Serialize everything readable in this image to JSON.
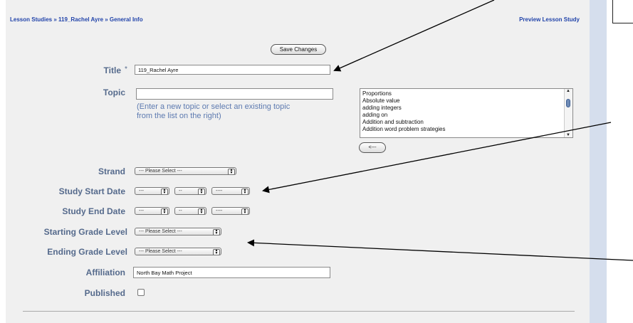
{
  "breadcrumb": {
    "text": "Lesson Studies » 119_Rachel Ayre » General Info",
    "preview_link": "Preview Lesson Study"
  },
  "save_button": "Save Changes",
  "form": {
    "title": {
      "label": "Title",
      "required_mark": "*",
      "value": "119_Rachel Ayre"
    },
    "topic": {
      "label": "Topic",
      "value": "",
      "hint": "(Enter a new topic or select an existing topic from the list on the right)",
      "options": [
        "Proportions",
        "Absolute value",
        "adding integers",
        "adding on",
        "Addition and subtraction",
        "Addition word problem strategies"
      ],
      "add_button": "<---"
    },
    "strand": {
      "label": "Strand",
      "selected": "--- Please Select ---"
    },
    "study_start_date": {
      "label": "Study Start Date",
      "month": "---",
      "day": "--",
      "year": "----"
    },
    "study_end_date": {
      "label": "Study End Date",
      "month": "---",
      "day": "--",
      "year": "----"
    },
    "starting_grade_level": {
      "label": "Starting Grade Level",
      "selected": "--- Please Select ---"
    },
    "ending_grade_level": {
      "label": "Ending Grade Level",
      "selected": "--- Please Select ---"
    },
    "affiliation": {
      "label": "Affiliation",
      "value": "North Bay Math Project"
    },
    "published": {
      "label": "Published",
      "checked": false
    }
  },
  "colors": {
    "label": "#556a8c",
    "link": "#2244aa",
    "hint": "#5d7ab0",
    "panel": "#f0f0f0",
    "stripe": "#d5deed"
  }
}
